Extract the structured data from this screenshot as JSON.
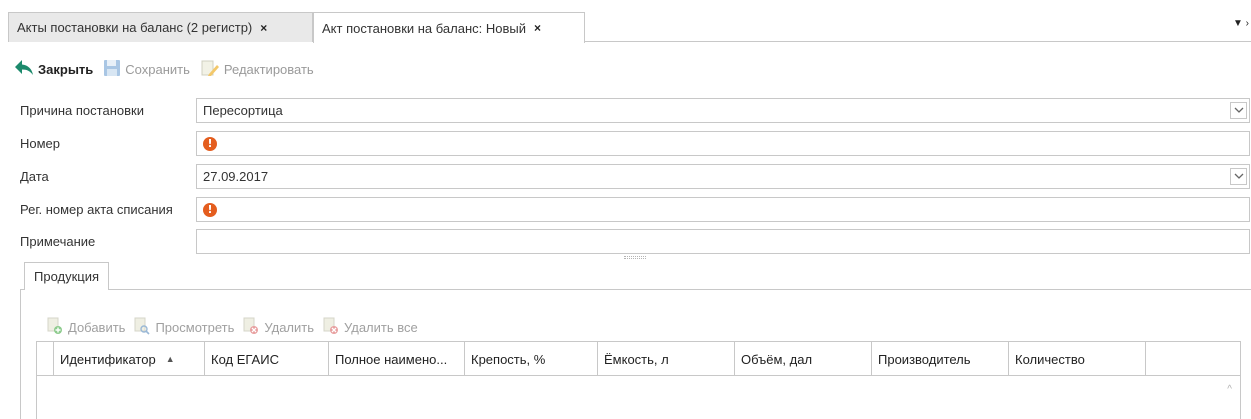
{
  "tabs": [
    {
      "label": "Акты постановки на баланс (2 регистр)",
      "active": false
    },
    {
      "label": "Акт постановки на баланс: Новый",
      "active": true
    }
  ],
  "tab_close_glyph": "×",
  "toolbar": {
    "close_label": "Закрыть",
    "save_label": "Сохранить",
    "edit_label": "Редактировать"
  },
  "form": {
    "reason": {
      "label": "Причина постановки",
      "value": "Пересортица"
    },
    "number": {
      "label": "Номер",
      "value": ""
    },
    "date": {
      "label": "Дата",
      "value": "27.09.2017"
    },
    "writeoff_reg_number": {
      "label": "Рег. номер акта списания",
      "value": ""
    },
    "note": {
      "label": "Примечание",
      "value": ""
    }
  },
  "products": {
    "tab_label": "Продукция",
    "toolbar": {
      "add_label": "Добавить",
      "view_label": "Просмотреть",
      "delete_label": "Удалить",
      "delete_all_label": "Удалить все"
    },
    "columns": [
      "Идентификатор",
      "Код ЕГАИС",
      "Полное наимено...",
      "Крепость, %",
      "Ёмкость, л",
      "Объём, дал",
      "Производитель",
      "Количество"
    ],
    "rows": []
  },
  "colors": {
    "accent_green": "#1c8a6c",
    "warning_orange": "#e45d1e",
    "border": "#c8c8c8"
  },
  "icons": [
    "back-arrow-icon",
    "floppy-disk-icon",
    "pencil-icon",
    "warning-icon",
    "dropdown-icon",
    "add-icon",
    "view-icon",
    "delete-icon",
    "sort-asc-icon"
  ]
}
